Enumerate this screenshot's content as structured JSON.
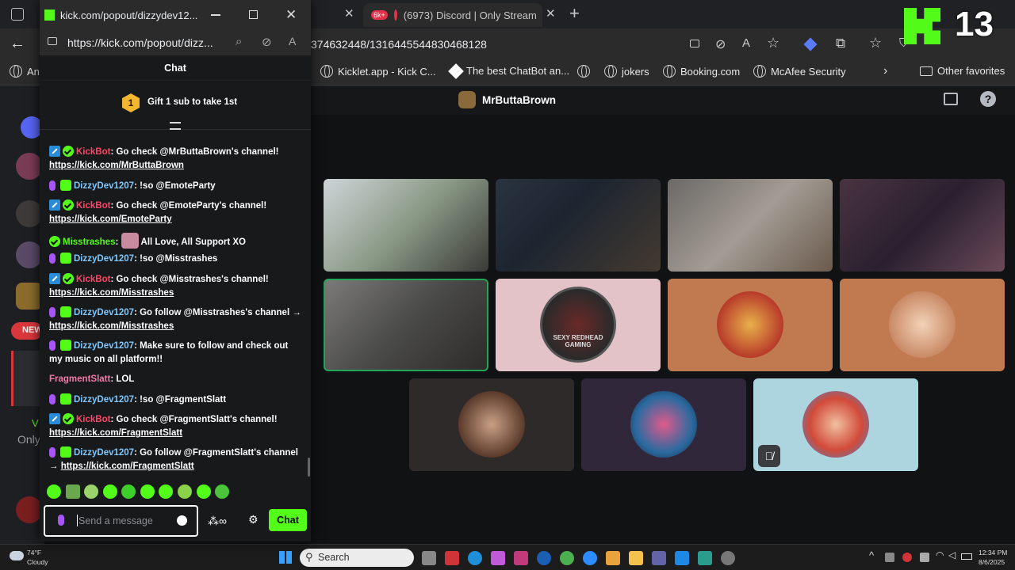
{
  "browser": {
    "tabs": [
      {
        "label": ""
      },
      {
        "label": "(6973) Discord | Only Stream",
        "badge": "6k+"
      }
    ],
    "address_tail": "374632448/1316445544830468128",
    "bookmarks": [
      {
        "label": "An"
      },
      {
        "label": "Kicklet.app - Kick C..."
      },
      {
        "label": "The best ChatBot an..."
      },
      {
        "label": "jokers"
      },
      {
        "label": "Booking.com"
      },
      {
        "label": "McAfee Security"
      }
    ],
    "other_favorites": "Other favorites"
  },
  "overlay": {
    "number": "13"
  },
  "discord": {
    "channel_name": "MrButtaBrown",
    "rail_texts": {
      "new_label": "NEW",
      "only_label": "Only",
      "v_label": "V"
    }
  },
  "popup": {
    "title": "kick.com/popout/dizzydev12...",
    "url": "https://kick.com/popout/dizz...",
    "chat_header": "Chat",
    "gift_number": "1",
    "gift_text": "Gift 1 sub to take 1st",
    "messages": [
      {
        "user": "KickBot",
        "text": ": Go check @MrButtaBrown's channel!",
        "link": "https://kick.com/MrButtaBrown"
      },
      {
        "user": "DizzyDev1207",
        "text": ": !so @EmoteParty"
      },
      {
        "user": "KickBot",
        "text": ": Go check @EmoteParty's channel!",
        "link": "https://kick.com/EmoteParty"
      },
      {
        "user": "Misstrashes",
        "text": ": ",
        "after": "All Love, All Support XO"
      },
      {
        "user": "DizzyDev1207",
        "text": ": !so @Misstrashes"
      },
      {
        "user": "KickBot",
        "text": ": Go check @Misstrashes's channel!",
        "link": "https://kick.com/Misstrashes"
      },
      {
        "user": "DizzyDev1207",
        "text": ": Go follow @Misstrashes's channel →",
        "link": "https://kick.com/Misstrashes"
      },
      {
        "user": "DizzyDev1207",
        "text": ": Make sure to follow and check out",
        "line2": "my music on all platform!!"
      },
      {
        "user": "FragmentSlatt",
        "text": ": LOL"
      },
      {
        "user": "DizzyDev1207",
        "text": ": !so @FragmentSlatt"
      },
      {
        "user": "KickBot",
        "text": ": Go check @FragmentSlatt's channel!",
        "link": "https://kick.com/FragmentSlatt"
      },
      {
        "user": "DizzyDev1207",
        "text": ": Go follow @FragmentSlatt's channel",
        "prefix": "→ ",
        "link": "https://kick.com/FragmentSlatt"
      }
    ],
    "input_placeholder": "Send a message",
    "chat_button": "Chat"
  },
  "tiles": {
    "row2": [
      {
        "label": "SEXY REDHEAD GAMING"
      }
    ]
  },
  "taskbar": {
    "weather_temp": "74°F",
    "weather_desc": "Cloudy",
    "search": "Search",
    "time": "12:34 PM",
    "date": "8/6/2025"
  },
  "colors": {
    "kick_green": "#53fc18",
    "discord_bg": "#111214",
    "popup_bg": "#18191b"
  }
}
